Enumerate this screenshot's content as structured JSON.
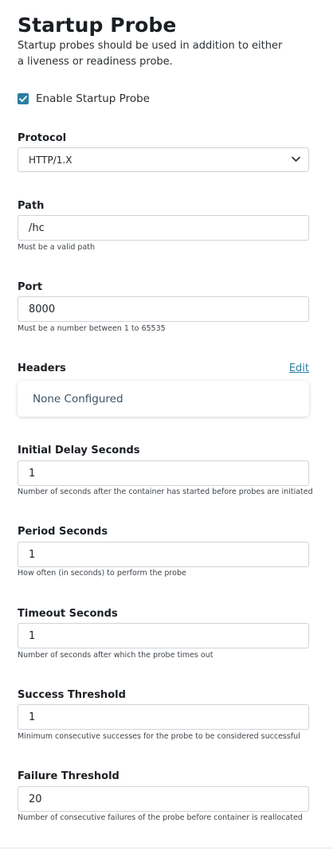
{
  "section": {
    "title": "Startup Probe",
    "subtitle": "Startup probes should be used in addition to either a liveness or readiness probe."
  },
  "enable_checkbox": {
    "label": "Enable Startup Probe",
    "checked": true,
    "color": "#2c7ea4"
  },
  "protocol": {
    "label": "Protocol",
    "value": "HTTP/1.X"
  },
  "path": {
    "label": "Path",
    "value": "/hc",
    "help": "Must be a valid path"
  },
  "port": {
    "label": "Port",
    "value": "8000",
    "help": "Must be a number between 1 to 65535"
  },
  "headers": {
    "label": "Headers",
    "edit_label": "Edit",
    "empty_text": "None Configured"
  },
  "initial_delay": {
    "label": "Initial Delay Seconds",
    "value": "1",
    "help": "Number of seconds after the container has started before probes are initiated"
  },
  "period": {
    "label": "Period Seconds",
    "value": "1",
    "help": "How often (in seconds) to perform the probe"
  },
  "timeout": {
    "label": "Timeout Seconds",
    "value": "1",
    "help": "Number of seconds after which the probe times out"
  },
  "success_threshold": {
    "label": "Success Threshold",
    "value": "1",
    "help": "Minimum consecutive successes for the probe to be considered successful"
  },
  "failure_threshold": {
    "label": "Failure Threshold",
    "value": "20",
    "help": "Number of consecutive failures of the probe before container is reallocated"
  }
}
